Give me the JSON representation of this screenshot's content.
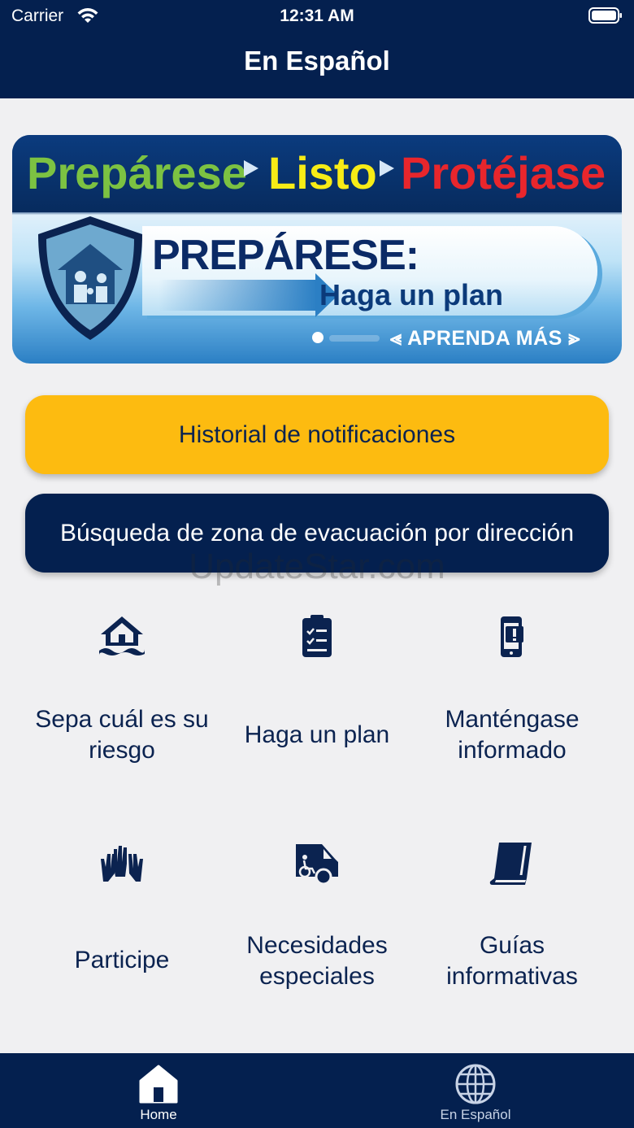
{
  "status_bar": {
    "carrier": "Carrier",
    "time": "12:31 AM"
  },
  "header": {
    "title": "En Español"
  },
  "banner": {
    "headline": [
      "Prepárese",
      "Listo",
      "Protéjase"
    ],
    "title": "PREPÁRESE:",
    "subtitle": "Haga un plan",
    "cta": "APRENDA MÁS",
    "page_index": 1
  },
  "buttons": {
    "notifications": "Historial de notificaciones",
    "evacuation_search": "Búsqueda de zona de evacuación por dirección"
  },
  "watermark": "UpdateStar.com",
  "tiles": [
    {
      "label": "Sepa cuál es su riesgo",
      "icon": "flood-house-icon"
    },
    {
      "label": "Haga un plan",
      "icon": "clipboard-checklist-icon"
    },
    {
      "label": "Manténgase informado",
      "icon": "phone-alert-icon"
    },
    {
      "label": "Participe",
      "icon": "raised-hands-icon"
    },
    {
      "label": "Necesidades especiales",
      "icon": "accessible-van-icon"
    },
    {
      "label": "Guías informativas",
      "icon": "book-icon"
    }
  ],
  "tabbar": {
    "home": "Home",
    "spanish": "En Español",
    "active": "home"
  },
  "colors": {
    "navy": "#04204f",
    "yellow": "#fdbb10",
    "background": "#f0f0f2",
    "green": "#7cc242",
    "lime": "#f7ec16",
    "red": "#e8262c"
  }
}
